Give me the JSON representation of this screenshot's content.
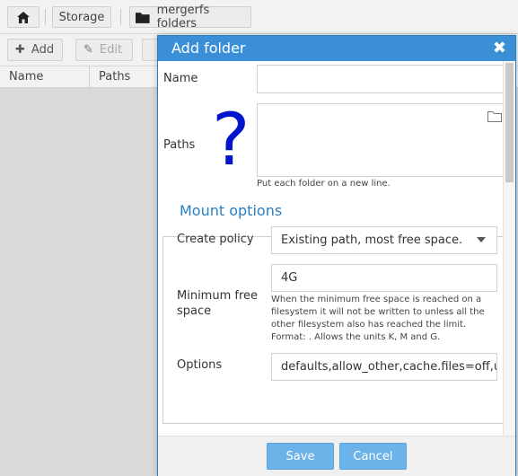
{
  "breadcrumb": {
    "home_icon": "home-icon",
    "storage": "Storage",
    "folder_icon": "folder-icon",
    "mergerfs": "mergerfs folders"
  },
  "toolbar": {
    "add_label": "Add",
    "add_icon": "plus-icon",
    "edit_label": "Edit",
    "edit_icon": "pencil-icon"
  },
  "grid": {
    "columns": [
      "Name",
      "Paths"
    ]
  },
  "dialog": {
    "title": "Add folder",
    "close_icon": "close-icon",
    "name_label": "Name",
    "name_value": "",
    "paths_label": "Paths",
    "paths_value": "",
    "paths_annotation": "?",
    "paths_hint": "Put each folder on a new line.",
    "mount_options_legend": "Mount options",
    "create_policy_label": "Create policy",
    "create_policy_value": "Existing path, most free space.",
    "min_free_label": "Minimum free space",
    "min_free_value": "4G",
    "min_free_hint": "When the minimum free space is reached on a filesystem it will not be written to unless all the other filesystem also has reached the limit. Format: . Allows the units K, M and G.",
    "options_label": "Options",
    "options_value": "defaults,allow_other,cache.files=off,us",
    "save_label": "Save",
    "cancel_label": "Cancel"
  },
  "colors": {
    "accent": "#3a8fd6",
    "button": "#6bb3e8",
    "annotation": "#0015cc"
  }
}
